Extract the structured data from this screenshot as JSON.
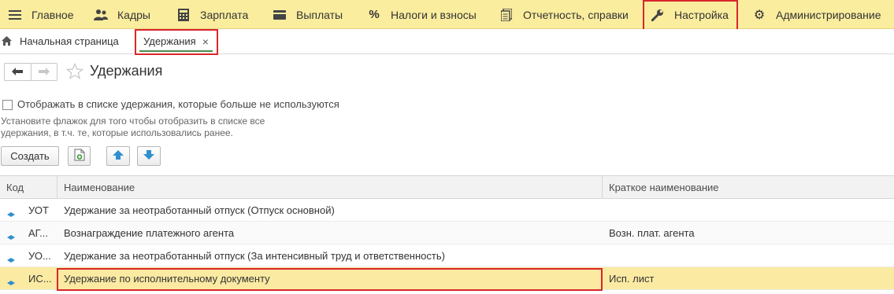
{
  "menu": {
    "items": [
      {
        "label": "Главное",
        "icon": "menu-lines-icon"
      },
      {
        "label": "Кадры",
        "icon": "users-icon"
      },
      {
        "label": "Зарплата",
        "icon": "calculator-icon"
      },
      {
        "label": "Выплаты",
        "icon": "wallet-icon"
      },
      {
        "label": "Налоги и взносы",
        "icon": "percent-icon"
      },
      {
        "label": "Отчетность, справки",
        "icon": "documents-icon"
      },
      {
        "label": "Настройка",
        "icon": "wrench-icon"
      },
      {
        "label": "Администрирование",
        "icon": "gear-icon"
      }
    ]
  },
  "tabs": {
    "home_label": "Начальная страница",
    "active_label": "Удержания",
    "close_glyph": "×"
  },
  "page": {
    "title": "Удержания",
    "checkbox_label": "Отображать в списке удержания, которые больше не используются",
    "hint_line1": "Установите флажок для того чтобы отобразить в списке все",
    "hint_line2": "удержания, в т.ч. те, которые использовались ранее.",
    "create_label": "Создать"
  },
  "table": {
    "columns": [
      "Код",
      "Наименование",
      "Краткое наименование"
    ],
    "rows": [
      {
        "code": "УОТ",
        "name": "Удержание за неотработанный отпуск (Отпуск основной)",
        "short": ""
      },
      {
        "code": "АГ...",
        "name": "Вознаграждение платежного агента",
        "short": "Возн. плат. агента"
      },
      {
        "code": "УО...",
        "name": "Удержание за неотработанный отпуск (За интенсивный труд и ответственность)",
        "short": ""
      },
      {
        "code": "ИС...",
        "name": "Удержание по исполнительному документу",
        "short": "Исп. лист"
      }
    ]
  },
  "colors": {
    "menu_bg": "#fbed9e",
    "highlight_red": "#d9262c",
    "selected_row": "#fbeaa2",
    "accent_blue": "#2f8fd0"
  }
}
